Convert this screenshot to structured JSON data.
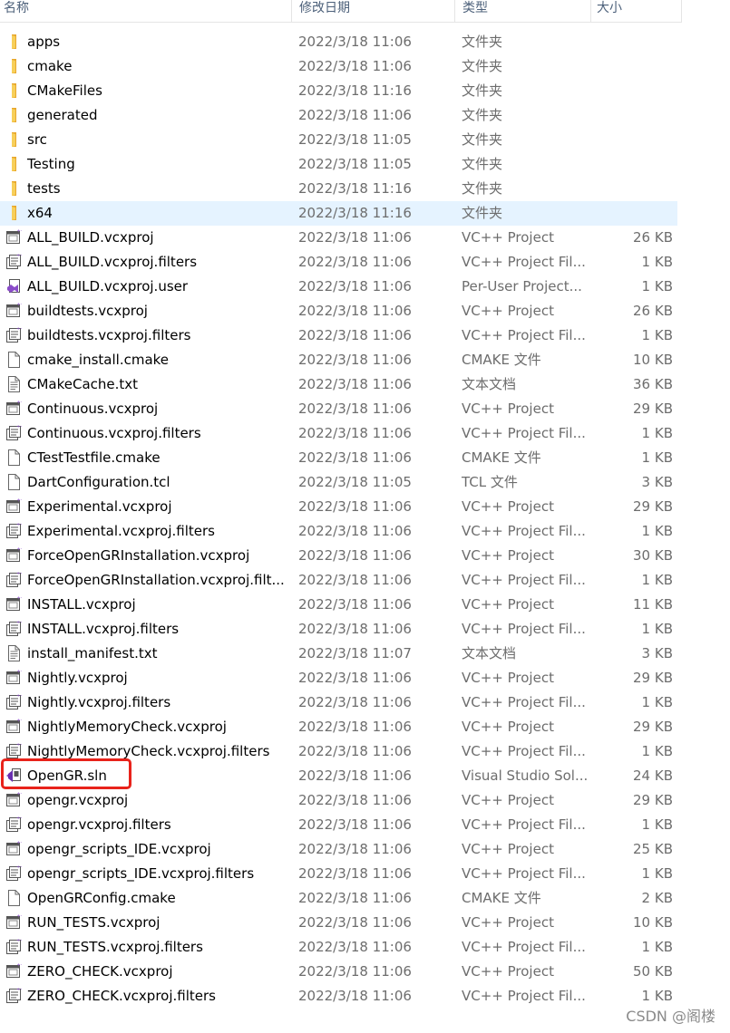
{
  "columns": {
    "name": "名称",
    "date": "修改日期",
    "type": "类型",
    "size": "大小"
  },
  "files": [
    {
      "name": "apps",
      "date": "2022/3/18 11:06",
      "type": "文件夹",
      "size": "",
      "icon": "folder-icon"
    },
    {
      "name": "cmake",
      "date": "2022/3/18 11:06",
      "type": "文件夹",
      "size": "",
      "icon": "folder-icon"
    },
    {
      "name": "CMakeFiles",
      "date": "2022/3/18 11:16",
      "type": "文件夹",
      "size": "",
      "icon": "folder-icon"
    },
    {
      "name": "generated",
      "date": "2022/3/18 11:06",
      "type": "文件夹",
      "size": "",
      "icon": "folder-icon"
    },
    {
      "name": "src",
      "date": "2022/3/18 11:05",
      "type": "文件夹",
      "size": "",
      "icon": "folder-icon"
    },
    {
      "name": "Testing",
      "date": "2022/3/18 11:05",
      "type": "文件夹",
      "size": "",
      "icon": "folder-icon"
    },
    {
      "name": "tests",
      "date": "2022/3/18 11:16",
      "type": "文件夹",
      "size": "",
      "icon": "folder-icon"
    },
    {
      "name": "x64",
      "date": "2022/3/18 11:16",
      "type": "文件夹",
      "size": "",
      "icon": "folder-icon",
      "selected": true
    },
    {
      "name": "ALL_BUILD.vcxproj",
      "date": "2022/3/18 11:06",
      "type": "VC++ Project",
      "size": "26 KB",
      "icon": "vcxproj-icon"
    },
    {
      "name": "ALL_BUILD.vcxproj.filters",
      "date": "2022/3/18 11:06",
      "type": "VC++ Project Fil...",
      "size": "1 KB",
      "icon": "filters-icon"
    },
    {
      "name": "ALL_BUILD.vcxproj.user",
      "date": "2022/3/18 11:06",
      "type": "Per-User Project...",
      "size": "1 KB",
      "icon": "user-project-icon"
    },
    {
      "name": "buildtests.vcxproj",
      "date": "2022/3/18 11:06",
      "type": "VC++ Project",
      "size": "26 KB",
      "icon": "vcxproj-icon"
    },
    {
      "name": "buildtests.vcxproj.filters",
      "date": "2022/3/18 11:06",
      "type": "VC++ Project Fil...",
      "size": "1 KB",
      "icon": "filters-icon"
    },
    {
      "name": "cmake_install.cmake",
      "date": "2022/3/18 11:06",
      "type": "CMAKE 文件",
      "size": "10 KB",
      "icon": "blank-file-icon"
    },
    {
      "name": "CMakeCache.txt",
      "date": "2022/3/18 11:06",
      "type": "文本文档",
      "size": "36 KB",
      "icon": "text-file-icon"
    },
    {
      "name": "Continuous.vcxproj",
      "date": "2022/3/18 11:06",
      "type": "VC++ Project",
      "size": "29 KB",
      "icon": "vcxproj-icon"
    },
    {
      "name": "Continuous.vcxproj.filters",
      "date": "2022/3/18 11:06",
      "type": "VC++ Project Fil...",
      "size": "1 KB",
      "icon": "filters-icon"
    },
    {
      "name": "CTestTestfile.cmake",
      "date": "2022/3/18 11:06",
      "type": "CMAKE 文件",
      "size": "1 KB",
      "icon": "blank-file-icon"
    },
    {
      "name": "DartConfiguration.tcl",
      "date": "2022/3/18 11:05",
      "type": "TCL 文件",
      "size": "3 KB",
      "icon": "blank-file-icon"
    },
    {
      "name": "Experimental.vcxproj",
      "date": "2022/3/18 11:06",
      "type": "VC++ Project",
      "size": "29 KB",
      "icon": "vcxproj-icon"
    },
    {
      "name": "Experimental.vcxproj.filters",
      "date": "2022/3/18 11:06",
      "type": "VC++ Project Fil...",
      "size": "1 KB",
      "icon": "filters-icon"
    },
    {
      "name": "ForceOpenGRInstallation.vcxproj",
      "date": "2022/3/18 11:06",
      "type": "VC++ Project",
      "size": "30 KB",
      "icon": "vcxproj-icon"
    },
    {
      "name": "ForceOpenGRInstallation.vcxproj.filt...",
      "date": "2022/3/18 11:06",
      "type": "VC++ Project Fil...",
      "size": "1 KB",
      "icon": "filters-icon"
    },
    {
      "name": "INSTALL.vcxproj",
      "date": "2022/3/18 11:06",
      "type": "VC++ Project",
      "size": "11 KB",
      "icon": "vcxproj-icon"
    },
    {
      "name": "INSTALL.vcxproj.filters",
      "date": "2022/3/18 11:06",
      "type": "VC++ Project Fil...",
      "size": "1 KB",
      "icon": "filters-icon"
    },
    {
      "name": "install_manifest.txt",
      "date": "2022/3/18 11:07",
      "type": "文本文档",
      "size": "3 KB",
      "icon": "text-file-icon"
    },
    {
      "name": "Nightly.vcxproj",
      "date": "2022/3/18 11:06",
      "type": "VC++ Project",
      "size": "29 KB",
      "icon": "vcxproj-icon"
    },
    {
      "name": "Nightly.vcxproj.filters",
      "date": "2022/3/18 11:06",
      "type": "VC++ Project Fil...",
      "size": "1 KB",
      "icon": "filters-icon"
    },
    {
      "name": "NightlyMemoryCheck.vcxproj",
      "date": "2022/3/18 11:06",
      "type": "VC++ Project",
      "size": "29 KB",
      "icon": "vcxproj-icon"
    },
    {
      "name": "NightlyMemoryCheck.vcxproj.filters",
      "date": "2022/3/18 11:06",
      "type": "VC++ Project Fil...",
      "size": "1 KB",
      "icon": "filters-icon"
    },
    {
      "name": "OpenGR.sln",
      "date": "2022/3/18 11:06",
      "type": "Visual Studio Sol...",
      "size": "24 KB",
      "icon": "visual-studio-solution-icon"
    },
    {
      "name": "opengr.vcxproj",
      "date": "2022/3/18 11:06",
      "type": "VC++ Project",
      "size": "29 KB",
      "icon": "vcxproj-icon"
    },
    {
      "name": "opengr.vcxproj.filters",
      "date": "2022/3/18 11:06",
      "type": "VC++ Project Fil...",
      "size": "1 KB",
      "icon": "filters-icon"
    },
    {
      "name": "opengr_scripts_IDE.vcxproj",
      "date": "2022/3/18 11:06",
      "type": "VC++ Project",
      "size": "25 KB",
      "icon": "vcxproj-icon"
    },
    {
      "name": "opengr_scripts_IDE.vcxproj.filters",
      "date": "2022/3/18 11:06",
      "type": "VC++ Project Fil...",
      "size": "1 KB",
      "icon": "filters-icon"
    },
    {
      "name": "OpenGRConfig.cmake",
      "date": "2022/3/18 11:06",
      "type": "CMAKE 文件",
      "size": "2 KB",
      "icon": "blank-file-icon"
    },
    {
      "name": "RUN_TESTS.vcxproj",
      "date": "2022/3/18 11:06",
      "type": "VC++ Project",
      "size": "10 KB",
      "icon": "vcxproj-icon"
    },
    {
      "name": "RUN_TESTS.vcxproj.filters",
      "date": "2022/3/18 11:06",
      "type": "VC++ Project Fil...",
      "size": "1 KB",
      "icon": "filters-icon"
    },
    {
      "name": "ZERO_CHECK.vcxproj",
      "date": "2022/3/18 11:06",
      "type": "VC++ Project",
      "size": "50 KB",
      "icon": "vcxproj-icon"
    },
    {
      "name": "ZERO_CHECK.vcxproj.filters",
      "date": "2022/3/18 11:06",
      "type": "VC++ Project Fil...",
      "size": "1 KB",
      "icon": "filters-icon"
    }
  ],
  "watermark": "CSDN @阁楼",
  "colors": {
    "selected_row": "#e5f3ff",
    "annotation": "#e8231b",
    "folder": "#f2c14e",
    "vs_purple": "#8a4cc9"
  }
}
